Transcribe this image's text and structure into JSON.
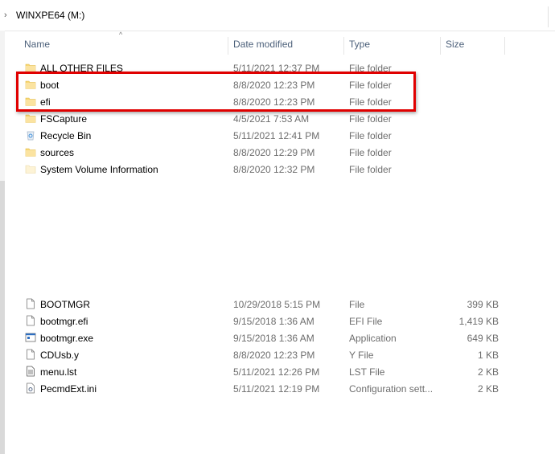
{
  "breadcrumb": {
    "path": "WINXPE64 (M:)"
  },
  "columns": {
    "name": "Name",
    "date": "Date modified",
    "type": "Type",
    "size": "Size"
  },
  "folders": [
    {
      "name": "ALL OTHER FILES",
      "date": "5/11/2021 12:37 PM",
      "type": "File folder",
      "icon": "folder-icon"
    },
    {
      "name": "boot",
      "date": "8/8/2020 12:23 PM",
      "type": "File folder",
      "icon": "folder-icon"
    },
    {
      "name": "efi",
      "date": "8/8/2020 12:23 PM",
      "type": "File folder",
      "icon": "folder-icon"
    },
    {
      "name": "FSCapture",
      "date": "4/5/2021 7:53 AM",
      "type": "File folder",
      "icon": "folder-icon"
    },
    {
      "name": "Recycle Bin",
      "date": "5/11/2021 12:41 PM",
      "type": "File folder",
      "icon": "recycle-bin-icon"
    },
    {
      "name": "sources",
      "date": "8/8/2020 12:29 PM",
      "type": "File folder",
      "icon": "folder-icon"
    },
    {
      "name": "System Volume Information",
      "date": "8/8/2020 12:32 PM",
      "type": "File folder",
      "icon": "system-folder-icon"
    }
  ],
  "files": [
    {
      "name": "BOOTMGR",
      "date": "10/29/2018 5:15 PM",
      "type": "File",
      "size": "399 KB",
      "icon": "file-icon"
    },
    {
      "name": "bootmgr.efi",
      "date": "9/15/2018 1:36 AM",
      "type": "EFI File",
      "size": "1,419 KB",
      "icon": "file-icon"
    },
    {
      "name": "bootmgr.exe",
      "date": "9/15/2018 1:36 AM",
      "type": "Application",
      "size": "649 KB",
      "icon": "application-icon"
    },
    {
      "name": "CDUsb.y",
      "date": "8/8/2020 12:23 PM",
      "type": "Y File",
      "size": "1 KB",
      "icon": "file-icon"
    },
    {
      "name": "menu.lst",
      "date": "5/11/2021 12:26 PM",
      "type": "LST File",
      "size": "2 KB",
      "icon": "text-file-icon"
    },
    {
      "name": "PecmdExt.ini",
      "date": "5/11/2021 12:19 PM",
      "type": "Configuration sett...",
      "size": "2 KB",
      "icon": "settings-file-icon"
    }
  ],
  "colors": {
    "highlight": "#e00000",
    "header_text": "#4c607a",
    "folder": "#f7d774"
  }
}
